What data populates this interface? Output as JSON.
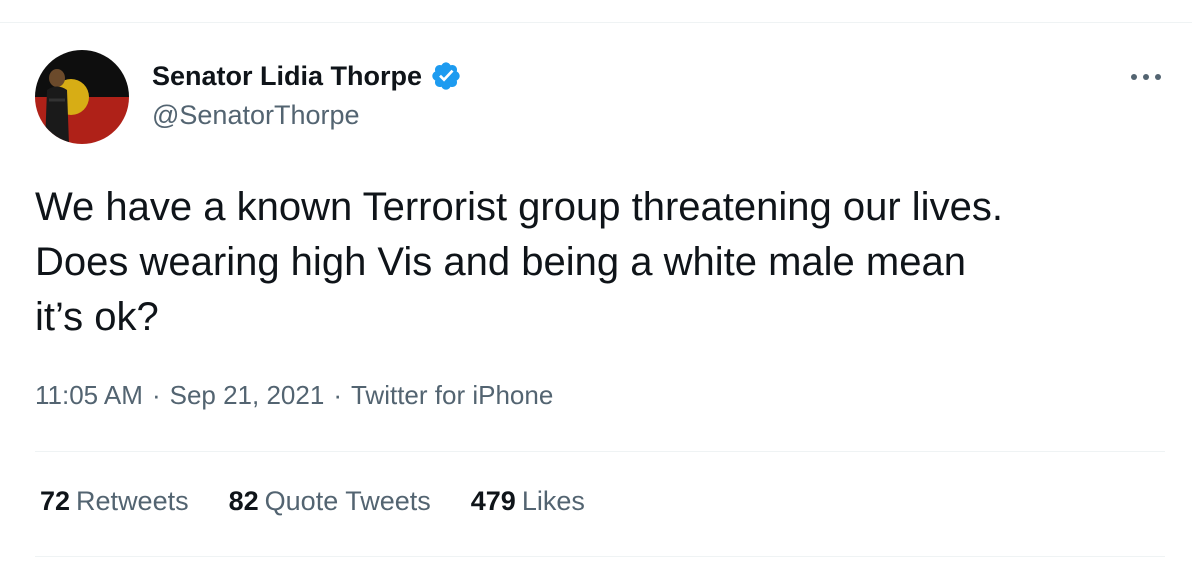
{
  "author": {
    "name": "Senator Lidia Thorpe",
    "handle": "@SenatorThorpe",
    "verified_color": "#1d9bf0"
  },
  "tweet": {
    "lines": [
      "We have a known Terrorist group threatening our lives.",
      "Does wearing high Vis and being a white male mean",
      "it’s ok?"
    ]
  },
  "meta": {
    "time": "11:05 AM",
    "date": "Sep 21, 2021",
    "source": "Twitter for iPhone",
    "separator": "·"
  },
  "stats": {
    "retweets_count": "72",
    "retweets_label": "Retweets",
    "quotes_count": "82",
    "quotes_label": "Quote Tweets",
    "likes_count": "479",
    "likes_label": "Likes"
  },
  "icons": {
    "verified": "verified-badge-icon",
    "more": "more-options-icon"
  },
  "colors": {
    "text": "#0f1419",
    "secondary": "#536471",
    "divider": "#eff3f4",
    "flag_black": "#111111",
    "flag_red": "#c8261c",
    "flag_yellow": "#f5c518"
  }
}
